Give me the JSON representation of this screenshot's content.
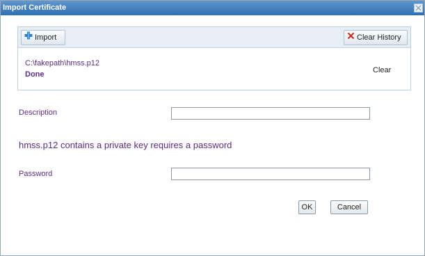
{
  "dialog": {
    "title": "Import Certificate",
    "close_icon": "close-icon"
  },
  "toolbar": {
    "import_label": "Import",
    "import_icon": "plus-icon",
    "clear_history_label": "Clear History",
    "clear_history_icon": "x-icon"
  },
  "file_entry": {
    "path": "C:\\fakepath\\hmss.p12",
    "status": "Done",
    "clear_label": "Clear"
  },
  "form": {
    "description_label": "Description",
    "description_value": "",
    "private_key_message": "hmss.p12 contains a private key requires a password",
    "password_label": "Password",
    "password_value": ""
  },
  "buttons": {
    "ok_label": "OK",
    "cancel_label": "Cancel"
  },
  "colors": {
    "titlebar": "#3a7cbd",
    "label_text": "#5a2d82",
    "toolbar_bg": "#e8eef5",
    "plus_icon": "#2f7fd0",
    "x_icon": "#d0201a"
  }
}
